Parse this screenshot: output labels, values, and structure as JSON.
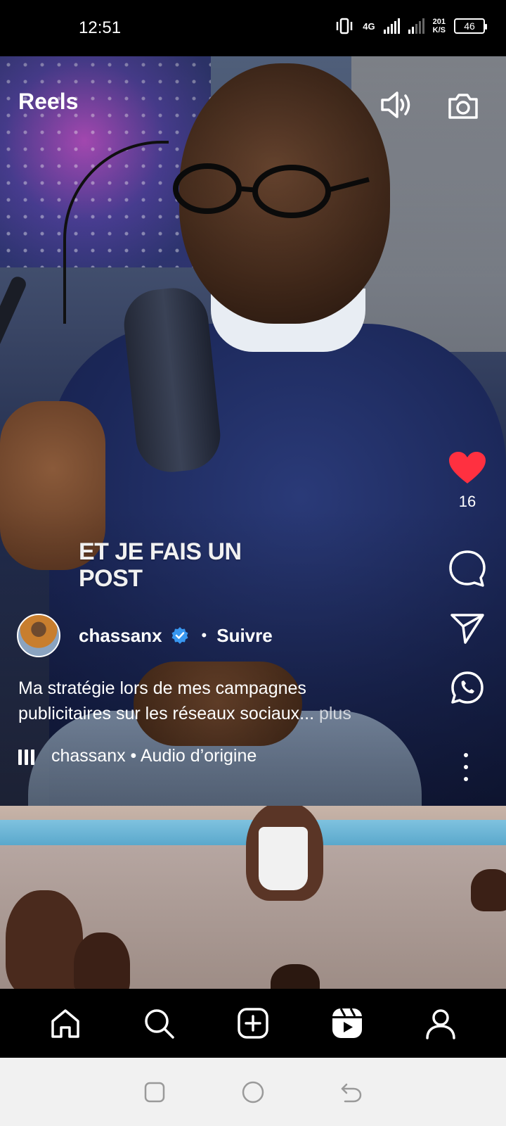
{
  "status_bar": {
    "time": "12:51",
    "network": "4G",
    "speed_value": "201",
    "speed_unit": "K/S",
    "battery": "46"
  },
  "header": {
    "title": "Reels",
    "icons": [
      "speaker-icon",
      "camera-icon"
    ]
  },
  "reel": {
    "overlay_line1": "ET JE FAIS UN",
    "overlay_line2": "POST",
    "likes": "16",
    "author": {
      "username": "chassanx",
      "verified": true,
      "separator": "•",
      "follow_label": "Suivre"
    },
    "description_line1": "Ma stratégie lors de mes campagnes",
    "description_line2": "publicitaires sur les réseaux sociaux...",
    "more_label": " plus",
    "audio": "chassanx • Audio d’origine"
  },
  "bottom_nav": [
    "home-icon",
    "search-icon",
    "create-icon",
    "reels-icon",
    "profile-icon"
  ],
  "system_nav": [
    "recents-icon",
    "home-circle-icon",
    "back-icon"
  ],
  "colors": {
    "like_red": "#ff3040",
    "verified_blue": "#3897f0",
    "background": "#000000",
    "system_nav_bg": "#f1f1f1"
  }
}
